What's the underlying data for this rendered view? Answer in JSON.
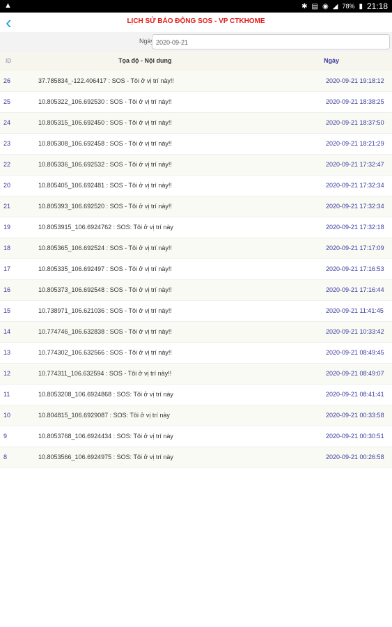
{
  "statusbar": {
    "warning_icon": "warning-icon",
    "battery": "78%",
    "time": "21:18"
  },
  "navbar": {
    "back_icon": "chevron-left-icon",
    "title": "LỊCH SỬ BÁO ĐỘNG SOS - VP CTKHOME"
  },
  "filter": {
    "label": "Ngày:",
    "date_value": "2020-09-21"
  },
  "table": {
    "headers": {
      "id": "ID",
      "content": "Tọa độ - Nội dung",
      "date": "Ngày"
    },
    "rows": [
      {
        "id": "26",
        "content": "37.785834_-122.406417 : SOS - Tôi ở vị trí này!!",
        "date": "2020-09-21 19:18:12"
      },
      {
        "id": "25",
        "content": "10.805322_106.692530 : SOS - Tôi ở vị trí này!!",
        "date": "2020-09-21 18:38:25"
      },
      {
        "id": "24",
        "content": "10.805315_106.692450 : SOS - Tôi ở vị trí này!!",
        "date": "2020-09-21 18:37:50"
      },
      {
        "id": "23",
        "content": "10.805308_106.692458 : SOS - Tôi ở vị trí này!!",
        "date": "2020-09-21 18:21:29"
      },
      {
        "id": "22",
        "content": "10.805336_106.692532 : SOS - Tôi ở vị trí này!!",
        "date": "2020-09-21 17:32:47"
      },
      {
        "id": "20",
        "content": "10.805405_106.692481 : SOS - Tôi ở vị trí này!!",
        "date": "2020-09-21 17:32:34"
      },
      {
        "id": "21",
        "content": "10.805393_106.692520 : SOS - Tôi ở vị trí này!!",
        "date": "2020-09-21 17:32:34"
      },
      {
        "id": "19",
        "content": "10.8053915_106.6924762 : SOS: Tôi ở vị trí này",
        "date": "2020-09-21 17:32:18"
      },
      {
        "id": "18",
        "content": "10.805365_106.692524 : SOS - Tôi ở vị trí này!!",
        "date": "2020-09-21 17:17:09"
      },
      {
        "id": "17",
        "content": "10.805335_106.692497 : SOS - Tôi ở vị trí này!!",
        "date": "2020-09-21 17:16:53"
      },
      {
        "id": "16",
        "content": "10.805373_106.692548 : SOS - Tôi ở vị trí này!!",
        "date": "2020-09-21 17:16:44"
      },
      {
        "id": "15",
        "content": "10.738971_106.621036 : SOS - Tôi ở vị trí này!!",
        "date": "2020-09-21 11:41:45"
      },
      {
        "id": "14",
        "content": "10.774746_106.632838 : SOS - Tôi ở vị trí này!!",
        "date": "2020-09-21 10:33:42"
      },
      {
        "id": "13",
        "content": "10.774302_106.632566 : SOS - Tôi ở vị trí này!!",
        "date": "2020-09-21 08:49:45"
      },
      {
        "id": "12",
        "content": "10.774311_106.632594 : SOS - Tôi ở vị trí này!!",
        "date": "2020-09-21 08:49:07"
      },
      {
        "id": "11",
        "content": "10.8053208_106.6924868 : SOS: Tôi ở vị trí này",
        "date": "2020-09-21 08:41:41"
      },
      {
        "id": "10",
        "content": "10.804815_106.6929087 : SOS: Tôi ở vị trí này",
        "date": "2020-09-21 00:33:58"
      },
      {
        "id": "9",
        "content": "10.8053768_106.6924434 : SOS: Tôi ở vị trí này",
        "date": "2020-09-21 00:30:51"
      },
      {
        "id": "8",
        "content": "10.8053566_106.6924975 : SOS: Tôi ở vị trí này",
        "date": "2020-09-21 00:26:58"
      }
    ]
  }
}
